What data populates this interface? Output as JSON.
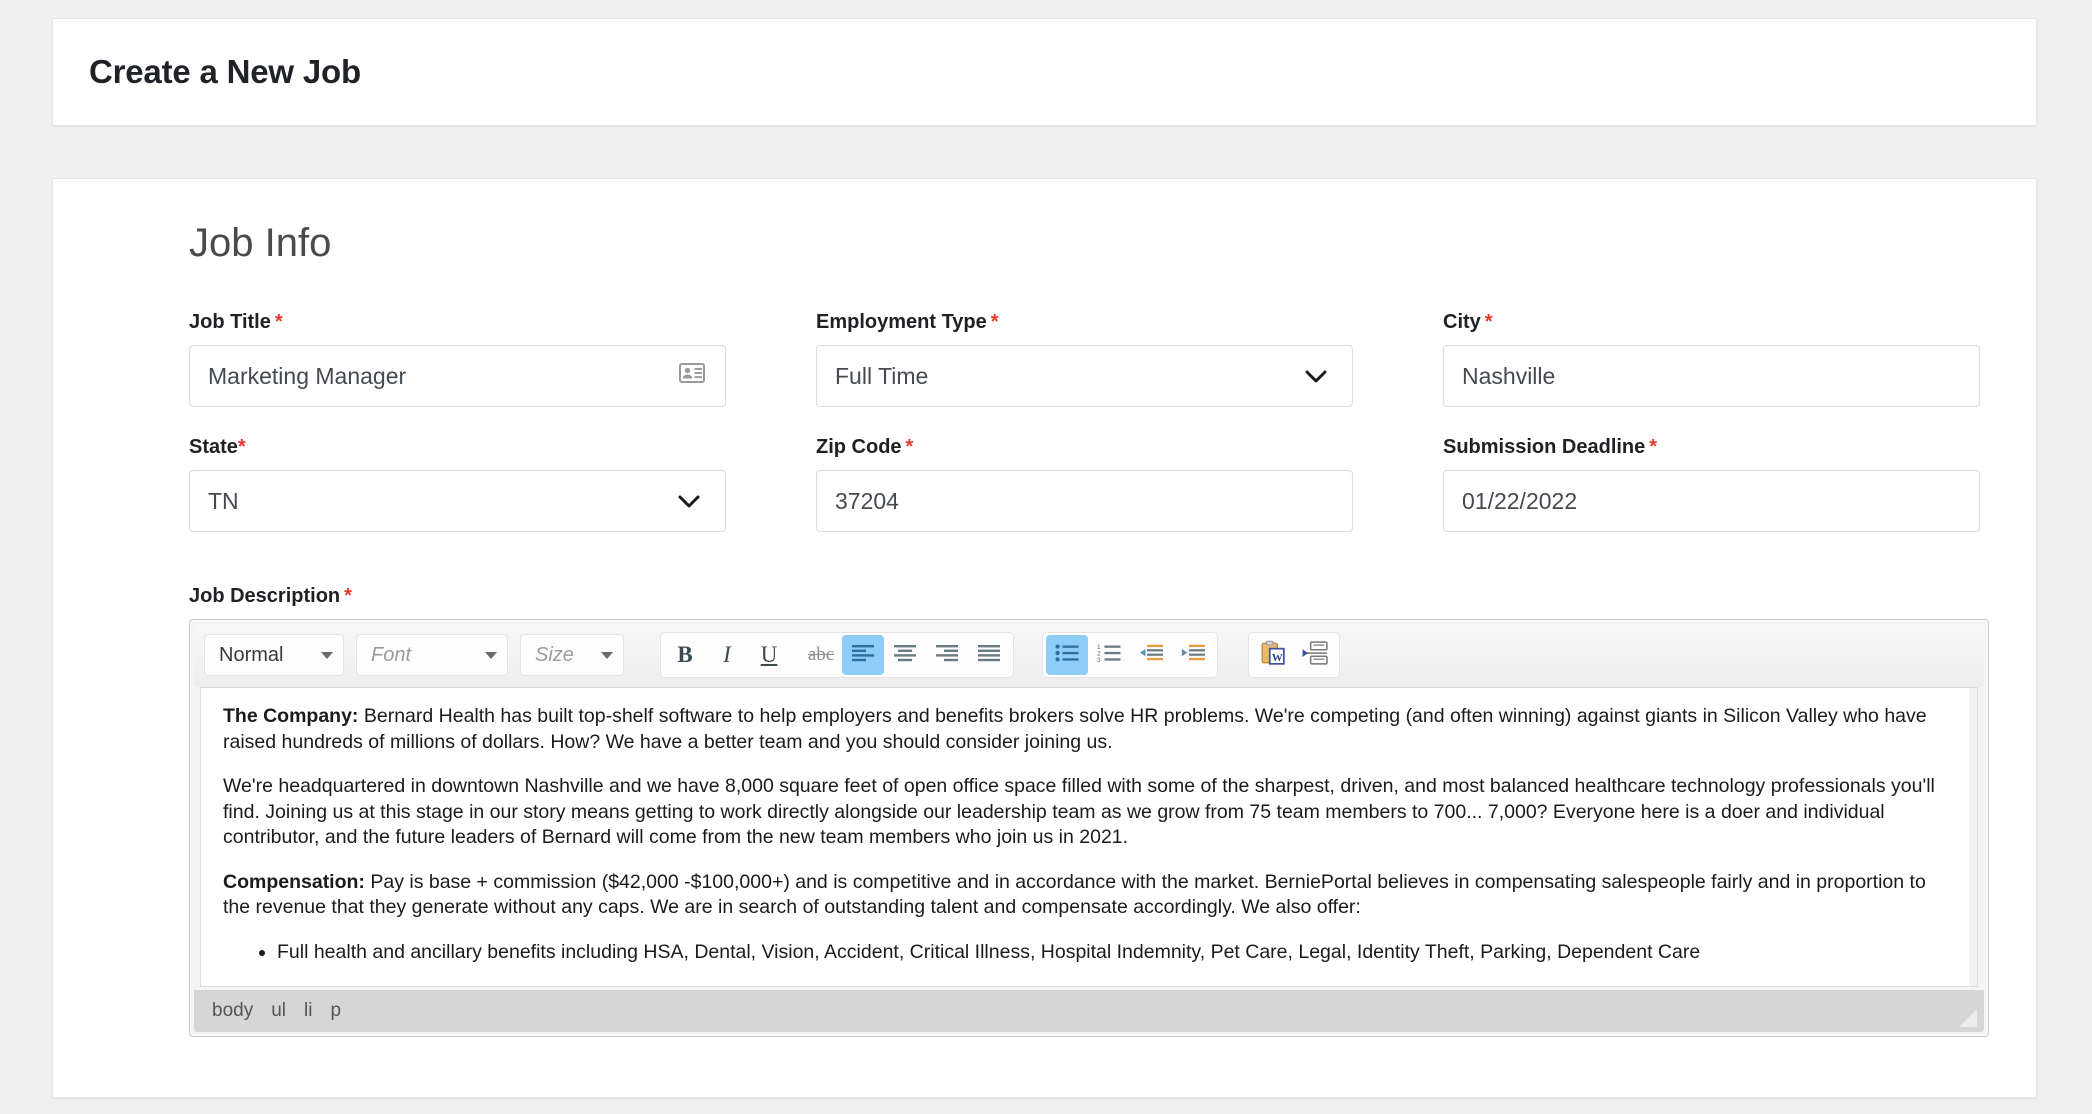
{
  "header": {
    "title": "Create a New Job"
  },
  "main": {
    "section_title": "Job Info",
    "fields": {
      "job_title": {
        "label": "Job Title",
        "required_mark": "*",
        "value": "Marketing Manager",
        "icon": "contact-card-icon"
      },
      "employment_type": {
        "label": "Employment Type",
        "required_mark": "*",
        "value": "Full Time",
        "icon": "chevron-down-icon"
      },
      "city": {
        "label": "City",
        "required_mark": "*",
        "value": "Nashville"
      },
      "state": {
        "label": "State",
        "required_mark": "*",
        "value": "TN",
        "icon": "chevron-down-icon"
      },
      "zip_code": {
        "label": "Zip Code",
        "required_mark": "*",
        "value": "37204"
      },
      "submission_deadline": {
        "label": "Submission Deadline",
        "required_mark": "*",
        "value": "01/22/2022"
      },
      "job_description": {
        "label": "Job Description",
        "required_mark": "*"
      }
    }
  },
  "editor": {
    "toolbar": {
      "format_select": "Normal",
      "font_select_placeholder": "Font",
      "size_select_placeholder": "Size",
      "bold": "B",
      "italic": "I",
      "underline": "U",
      "strikethrough": "abc",
      "align_left": "align-left-icon",
      "align_center": "align-center-icon",
      "align_right": "align-right-icon",
      "align_justify": "align-justify-icon",
      "bullet_list": "bullet-list-icon",
      "numbered_list": "numbered-list-icon",
      "outdent": "outdent-icon",
      "indent": "indent-icon",
      "paste_from_word": "paste-from-word-icon",
      "page_break": "page-break-icon",
      "active_buttons": [
        "align_left",
        "bullet_list"
      ]
    },
    "content": {
      "paragraphs": [
        {
          "lead": "The Company:",
          "text": " Bernard Health has built top-shelf software to help employers and benefits brokers solve HR problems. We're competing (and often winning) against giants in Silicon Valley who have raised hundreds of millions of dollars. How? We have a better team and you should consider joining us."
        },
        {
          "lead": "",
          "text": "We're headquartered in downtown Nashville and we have 8,000 square feet of open office space filled with some of the sharpest, driven, and most balanced healthcare technology professionals you'll find. Joining us at this stage in our story means getting to work directly alongside our leadership team as we grow from 75 team members to 700... 7,000? Everyone here is a doer and individual contributor, and the future leaders of Bernard will come from the new team members who join us in 2021."
        },
        {
          "lead": "Compensation:",
          "text": " Pay is base + commission ($42,000 -$100,000+) and is competitive and in accordance with the market. BerniePortal believes in compensating salespeople fairly and in proportion to the revenue that they generate without any caps. We are in search of outstanding talent and compensate accordingly. We also offer:"
        }
      ],
      "bullets": [
        "Full health and ancillary benefits including HSA, Dental, Vision, Accident, Critical Illness, Hospital Indemnity, Pet Care, Legal, Identity Theft, Parking, Dependent Care"
      ]
    },
    "status_path": [
      "body",
      "ul",
      "li",
      "p"
    ],
    "resize_handle": "resize-grip-icon"
  },
  "colors": {
    "required_asterisk": "#e8392a",
    "toolbar_active": "#8ecdf7",
    "page_background": "#f0f0f0",
    "card_background": "#ffffff"
  }
}
